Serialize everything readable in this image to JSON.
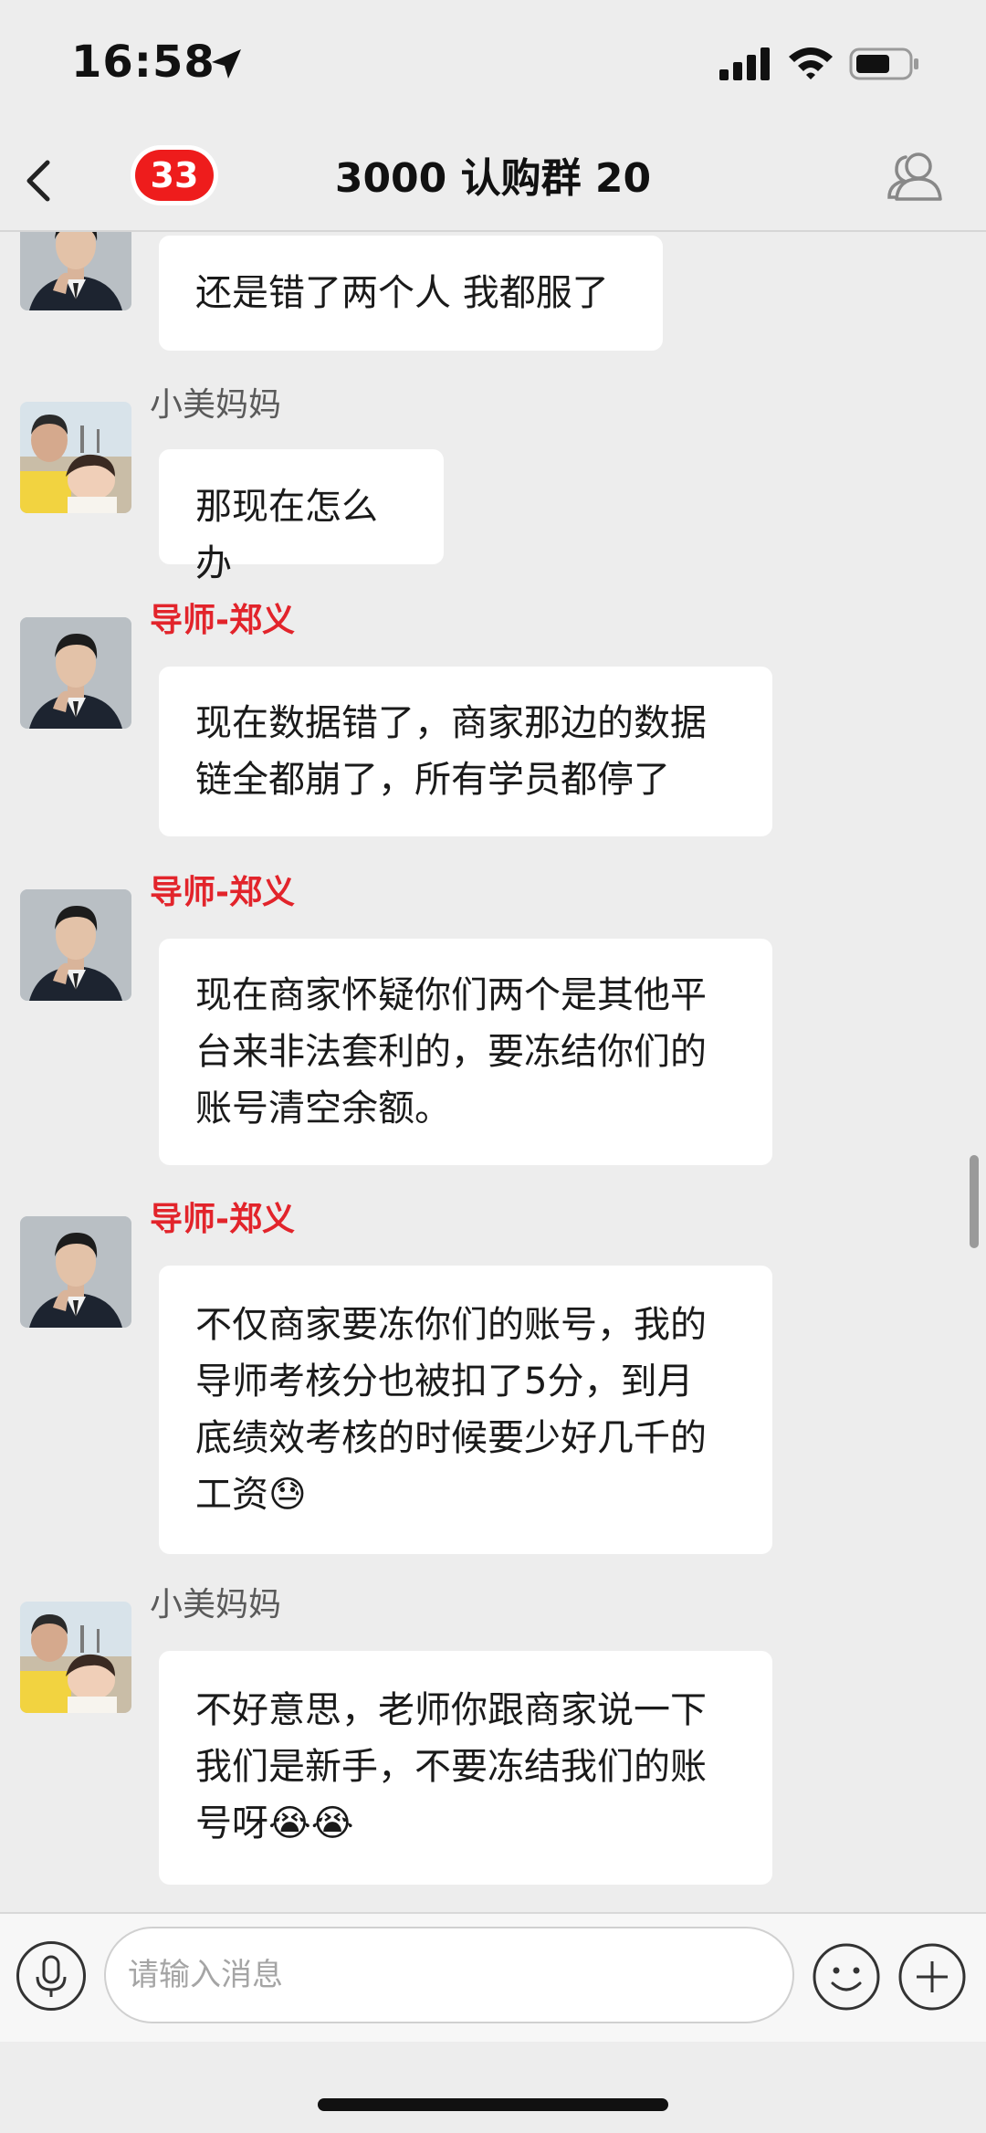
{
  "status_bar": {
    "time": "16:58"
  },
  "nav": {
    "unread_count": "33",
    "title": "3000 认购群 20"
  },
  "messages": [
    {
      "sender": "",
      "text": "还是错了两个人  我都服了"
    },
    {
      "sender": "小美妈妈",
      "text": "那现在怎么办"
    },
    {
      "sender": "导师-郑义",
      "lines": [
        "现在数据错了，商家那边的数据",
        "链全都崩了，所有学员都停了"
      ]
    },
    {
      "sender": "导师-郑义",
      "lines": [
        "现在商家怀疑你们两个是其他平",
        "台来非法套利的，要冻结你们的",
        "账号清空余额。"
      ]
    },
    {
      "sender": "导师-郑义",
      "lines": [
        "不仅商家要冻你们的账号，我的",
        "导师考核分也被扣了5分，到月",
        "底绩效考核的时候要少好几千的",
        "工资😓"
      ]
    },
    {
      "sender": "小美妈妈",
      "lines": [
        "不好意思，老师你跟商家说一下",
        "我们是新手，不要冻结我们的账",
        "号呀😭😭"
      ]
    }
  ],
  "input": {
    "placeholder": "请输入消息",
    "value": ""
  },
  "icons": {
    "back": "back-icon",
    "members": "group-members-icon",
    "mic": "microphone-icon",
    "emoji": "smiley-icon",
    "plus": "plus-icon",
    "location": "location-arrow-icon",
    "signal": "cellular-signal-icon",
    "wifi": "wifi-icon",
    "battery": "battery-icon"
  },
  "colors": {
    "badge": "#ee1c1c",
    "tutor_name": "#e2242b",
    "background": "#ededed",
    "bubble": "#ffffff"
  }
}
